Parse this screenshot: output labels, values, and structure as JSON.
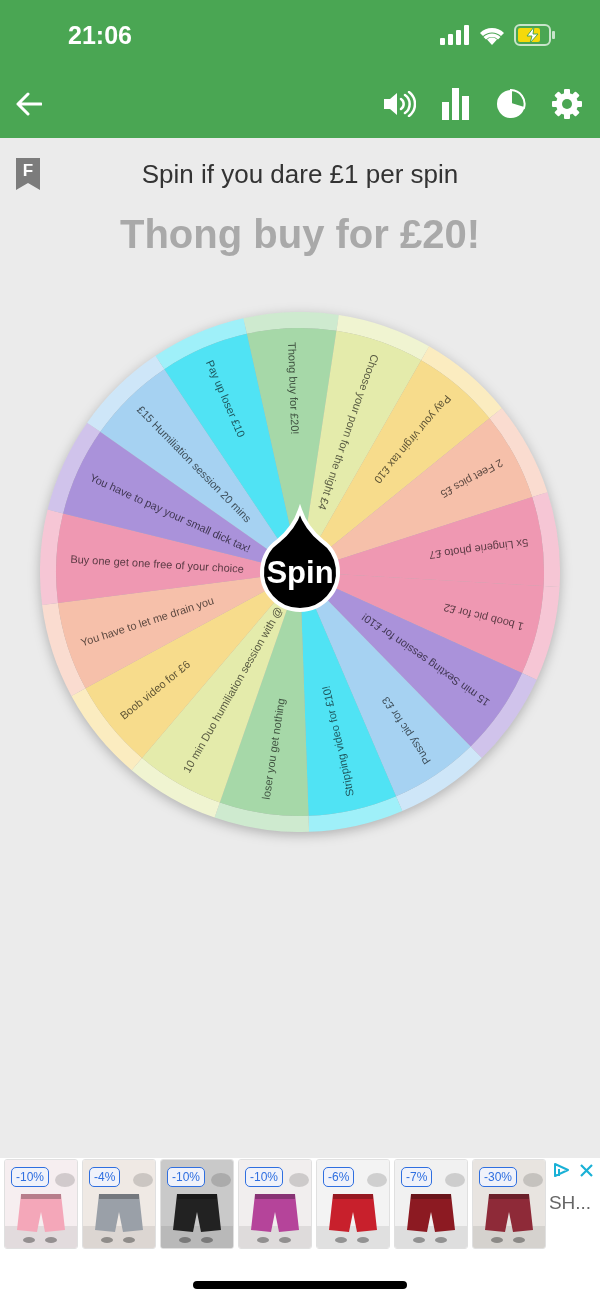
{
  "status_bar": {
    "time": "21:06"
  },
  "header": {
    "badge": "F",
    "title": "Spin if you dare £1 per spin",
    "result": "Thong buy for £20!"
  },
  "wheel": {
    "button": "Spin",
    "segments": [
      {
        "label": "Thong buy for £20!",
        "color": "#a6d8a8"
      },
      {
        "label": "Choose your porn for the night £4",
        "color": "#e4ebab"
      },
      {
        "label": "Pay your virgin tax £10",
        "color": "#f7dc8c"
      },
      {
        "label": "2 Feet pics £5",
        "color": "#f6c0aa"
      },
      {
        "label": "5x Lingerie photo £7",
        "color": "#ef98b2"
      },
      {
        "label": "1 boob pic for £2",
        "color": "#ef98b2"
      },
      {
        "label": "15 min Sexting session for £10!",
        "color": "#aa92da"
      },
      {
        "label": "Pussy pic for £3",
        "color": "#a6d2f2"
      },
      {
        "label": "Stripping video for £10!",
        "color": "#50e3f4"
      },
      {
        "label": "loser you get nothing",
        "color": "#a6d8a8"
      },
      {
        "label": "10 min Duo humiliation session with @",
        "color": "#e4ebab"
      },
      {
        "label": "Boob video for £6",
        "color": "#f7dc8c"
      },
      {
        "label": "You have to let me drain you",
        "color": "#f6c0aa"
      },
      {
        "label": "Buy one get one free of your choice",
        "color": "#ef98b2"
      },
      {
        "label": "You have to pay your small dick tax!",
        "color": "#aa92da"
      },
      {
        "label": "£15 Humiliation session 20 mins",
        "color": "#a6d2f2"
      },
      {
        "label": "Pay up loser £10",
        "color": "#50e3f4"
      }
    ]
  },
  "ad": {
    "products": [
      {
        "discount": "-10%"
      },
      {
        "discount": "-4%"
      },
      {
        "discount": "-10%"
      },
      {
        "discount": "-10%"
      },
      {
        "discount": "-6%"
      },
      {
        "discount": "-7%"
      },
      {
        "discount": "-30%"
      }
    ],
    "text": "SH..."
  }
}
